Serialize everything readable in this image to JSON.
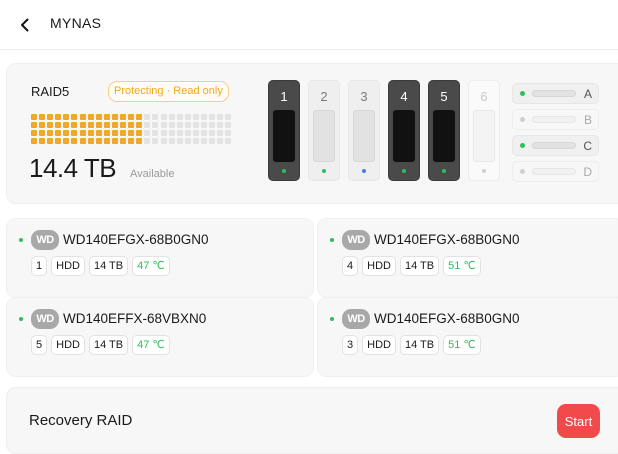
{
  "header": {
    "title": "MYNAS",
    "back_icon": "chevron-left-icon"
  },
  "raid": {
    "level": "RAID5",
    "status": "Protecting · Read only",
    "capacity": "14.4 TB",
    "capacity_label": "Available",
    "used_fraction": 0.54,
    "bays": [
      {
        "label": "1",
        "state": "active",
        "led": "#2fbd5b"
      },
      {
        "label": "2",
        "state": "idle",
        "led": "#2fbd5b"
      },
      {
        "label": "3",
        "state": "idle",
        "led": "#4a7be8"
      },
      {
        "label": "4",
        "state": "active",
        "led": "#2fbd5b"
      },
      {
        "label": "5",
        "state": "active",
        "led": "#2fbd5b"
      },
      {
        "label": "6",
        "state": "empty",
        "led": "#d0d0d0"
      }
    ],
    "slots": [
      {
        "label": "A",
        "state": "on",
        "led": "#2fbd5b"
      },
      {
        "label": "B",
        "state": "off",
        "led": "#cfcfcf"
      },
      {
        "label": "C",
        "state": "on",
        "led": "#2fbd5b"
      },
      {
        "label": "D",
        "state": "off",
        "led": "#cfcfcf"
      }
    ]
  },
  "disks": [
    {
      "brand": "WD",
      "model": "WD140EFGX-68B0GN0",
      "bay": "1",
      "type": "HDD",
      "size": "14 TB",
      "temp": "47 ℃"
    },
    {
      "brand": "WD",
      "model": "WD140EFGX-68B0GN0",
      "bay": "4",
      "type": "HDD",
      "size": "14 TB",
      "temp": "51 ℃"
    },
    {
      "brand": "WD",
      "model": "WD140EFFX-68VBXN0",
      "bay": "5",
      "type": "HDD",
      "size": "14 TB",
      "temp": "47 ℃"
    },
    {
      "brand": "WD",
      "model": "WD140EFGX-68B0GN0",
      "bay": "3",
      "type": "HDD",
      "size": "14 TB",
      "temp": "51 ℃"
    }
  ],
  "recovery": {
    "label": "Recovery RAID",
    "button": "Start"
  },
  "colors": {
    "accent": "#f4a820",
    "danger": "#f24a4a",
    "ok": "#2fbd5b"
  }
}
